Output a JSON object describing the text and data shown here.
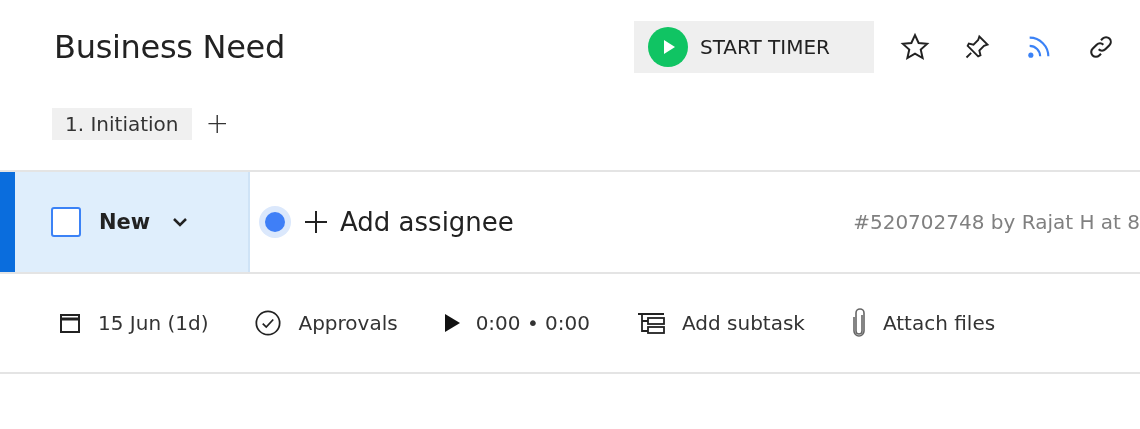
{
  "title": "Business Need",
  "timer_button": {
    "label": "START TIMER"
  },
  "toolbar": {
    "starred": false,
    "subscribed": true
  },
  "stages": [
    {
      "label": "1. Initiation"
    }
  ],
  "add_stage": {
    "label": "+"
  },
  "status": {
    "label": "New",
    "checked": false
  },
  "assignee": {
    "label": "Add assignee"
  },
  "meta": "#520702748 by Rajat H at 8",
  "actions": [
    {
      "kind": "date",
      "label": "15 Jun (1d)"
    },
    {
      "kind": "approvals",
      "label": "Approvals"
    },
    {
      "kind": "time",
      "label": "0:00 • 0:00"
    },
    {
      "kind": "subtask",
      "label": "Add subtask"
    },
    {
      "kind": "attach",
      "label": "Attach files"
    }
  ]
}
